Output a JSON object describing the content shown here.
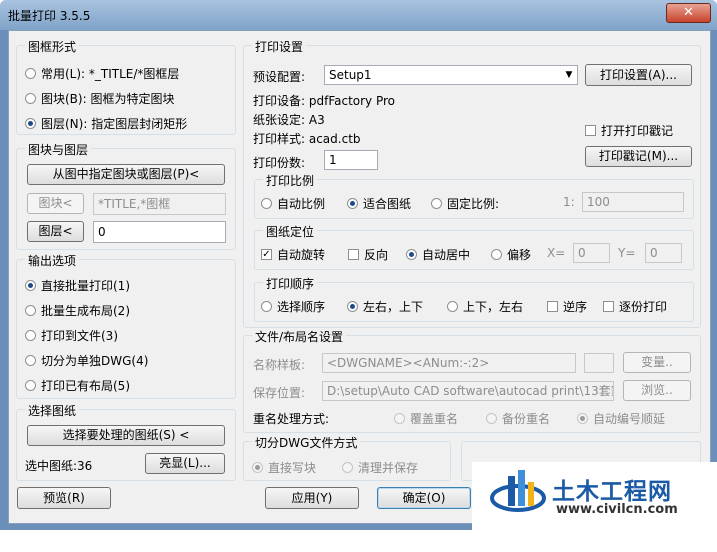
{
  "window": {
    "title": "批量打印 3.5.5",
    "close": "✕"
  },
  "frame_form": {
    "title": "图框形式",
    "options": [
      "常用(L): *_TITLE/*图框层",
      "图块(B): 图框为特定图块",
      "图层(N): 指定图层封闭矩形"
    ],
    "selected": 2
  },
  "block_layer": {
    "title": "图块与图层",
    "pick_button": "从图中指定图块或图层(P)<",
    "block_button": "图块<",
    "block_value": "*TITLE,*图框",
    "layer_button": "图层<",
    "layer_value": "0"
  },
  "output": {
    "title": "输出选项",
    "options": [
      "直接批量打印(1)",
      "批量生成布局(2)",
      "打印到文件(3)",
      "切分为单独DWG(4)",
      "打印已有布局(5)"
    ],
    "selected": 0
  },
  "select_drawings": {
    "title": "选择图纸",
    "button": "选择要处理的图纸(S) <",
    "count_label": "选中图纸:36",
    "highlight_button": "亮显(L)..."
  },
  "print_settings": {
    "title": "打印设置",
    "preset_label": "预设配置:",
    "preset_value": "Setup1",
    "settings_button": "打印设置(A)...",
    "device": "打印设备: pdfFactory Pro",
    "paper": "纸张设定: A3",
    "style": "打印样式: acad.ctb",
    "copies_label": "打印份数:",
    "copies_value": "1",
    "stamp_check": "打开打印戳记",
    "stamp_button": "打印戳记(M)..."
  },
  "scale": {
    "title": "打印比例",
    "options": [
      "自动比例",
      "适合图纸",
      "固定比例:"
    ],
    "selected": 1,
    "ratio_label": "1:",
    "ratio_value": "100"
  },
  "position": {
    "title": "图纸定位",
    "auto_rotate": "自动旋转",
    "reverse": "反向",
    "center": "自动居中",
    "offset": "偏移",
    "x_label": "X=",
    "x_value": "0",
    "y_label": "Y=",
    "y_value": "0"
  },
  "order": {
    "title": "打印顺序",
    "options": [
      "选择顺序",
      "左右，上下",
      "上下，左右"
    ],
    "selected": 1,
    "reverse": "逆序",
    "per_copy": "逐份打印"
  },
  "file_names": {
    "title": "文件/布局名设置",
    "name_label": "名称样板:",
    "name_value": "<DWGNAME><ANum:-:2>",
    "var_button": "变量..",
    "path_label": "保存位置:",
    "path_value": "D:\\setup\\Auto CAD software\\autocad print\\13套家装案例",
    "browse_button": "浏览..",
    "dup_label": "重名处理方式:",
    "dup_options": [
      "覆盖重名",
      "备份重名",
      "自动编号顺延"
    ],
    "dup_selected": 2
  },
  "split": {
    "title": "切分DWG文件方式",
    "options": [
      "直接写块",
      "清理并保存"
    ],
    "selected": 0
  },
  "footer": {
    "preview": "预览(R)",
    "apply": "应用(Y)",
    "ok": "确定(O)"
  },
  "watermark": {
    "name": "土木工程网",
    "url": "www.civilcn.com"
  },
  "colors": {
    "title_bar": "#7fa3c9",
    "dialog_bg": "#f0f0f0",
    "accent": "#1a5aa6"
  }
}
